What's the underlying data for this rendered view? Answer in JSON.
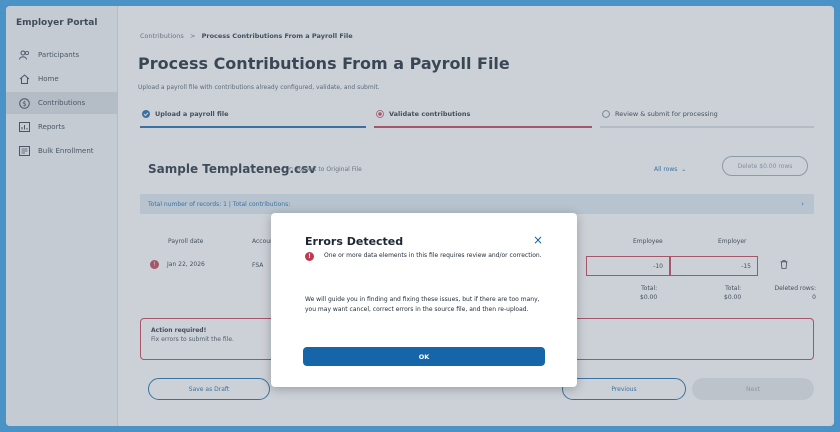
{
  "sidebar": {
    "brand": "Employer Portal",
    "items": [
      {
        "label": "Participants"
      },
      {
        "label": "Home"
      },
      {
        "label": "Contributions"
      },
      {
        "label": "Reports"
      },
      {
        "label": "Bulk Enrollment"
      }
    ]
  },
  "breadcrumb": {
    "parent": "Contributions",
    "separator": ">",
    "current": "Process Contributions From a Payroll File"
  },
  "page": {
    "title": "Process Contributions From a Payroll File",
    "subtitle": "Upload a payroll file with contributions already configured, validate, and submit."
  },
  "steps": [
    {
      "label": "Upload a payroll file",
      "status": "complete"
    },
    {
      "label": "Validate contributions",
      "status": "current"
    },
    {
      "label": "Review & submit for processing",
      "status": "pending"
    }
  ],
  "file": {
    "name": "Sample Templateneg.csv",
    "revert_label": "Revert to Original File",
    "rows_filter": "All rows",
    "delete_label": "Delete $0.00 rows"
  },
  "summary": {
    "text": "Total number of records: 1 | Total contributions:"
  },
  "table": {
    "headers": {
      "payroll_date": "Payroll date",
      "account": "Accoun",
      "employee": "Employee",
      "employer": "Employer"
    },
    "row": {
      "date": "Jan 22, 2026",
      "account": "FSA",
      "employee": "-10",
      "employer": "-15"
    },
    "totals": {
      "employee_label": "Total:",
      "employee_value": "$0.00",
      "employer_label": "Total:",
      "employer_value": "$0.00",
      "deleted_label": "Deleted rows:",
      "deleted_value": "0"
    }
  },
  "alert": {
    "heading": "Action required!",
    "text": "Fix errors to submit the file."
  },
  "footer": {
    "save_draft": "Save as Draft",
    "previous": "Previous",
    "next": "Next"
  },
  "modal": {
    "title": "Errors Detected",
    "alert_text": "One or more data elements in this file requires review and/or correction.",
    "body": "We will guide you in finding and fixing these issues, but if there are too many, you may want cancel, correct errors in the source file, and then re-upload.",
    "ok_label": "OK",
    "close_symbol": "×"
  },
  "colors": {
    "accent": "#1565a8",
    "error": "#c0394d",
    "frame": "#2f9be6"
  }
}
